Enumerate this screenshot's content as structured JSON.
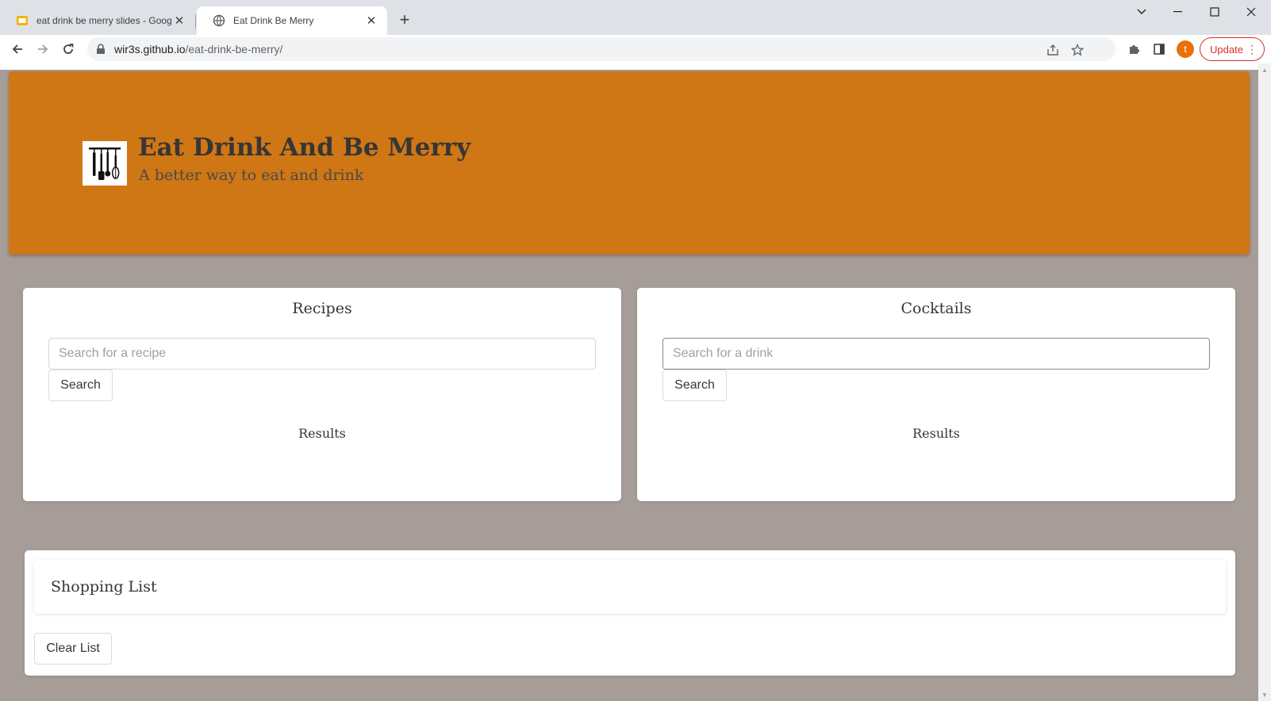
{
  "browser": {
    "tabs": [
      {
        "title": "eat drink be merry slides - Googl",
        "favicon": "google-slides-icon",
        "active": false
      },
      {
        "title": "Eat Drink Be Merry",
        "favicon": "globe-icon",
        "active": true
      }
    ],
    "url_host": "wir3s.github.io",
    "url_path": "/eat-drink-be-merry/",
    "profile_initial": "t",
    "update_label": "Update",
    "colors": {
      "accent_update": "#d93025",
      "avatar": "#e8710a"
    }
  },
  "page": {
    "title": "Eat Drink And Be Merry",
    "subtitle": "A better way to eat and drink",
    "colors": {
      "hero": "#cf7615",
      "background": "#a69c98"
    },
    "recipes": {
      "heading": "Recipes",
      "placeholder": "Search for a recipe",
      "button": "Search",
      "results": "Results"
    },
    "cocktails": {
      "heading": "Cocktails",
      "placeholder": "Search for a drink",
      "button": "Search",
      "results": "Results"
    },
    "shopping": {
      "heading": "Shopping List",
      "clear_button": "Clear List"
    }
  }
}
